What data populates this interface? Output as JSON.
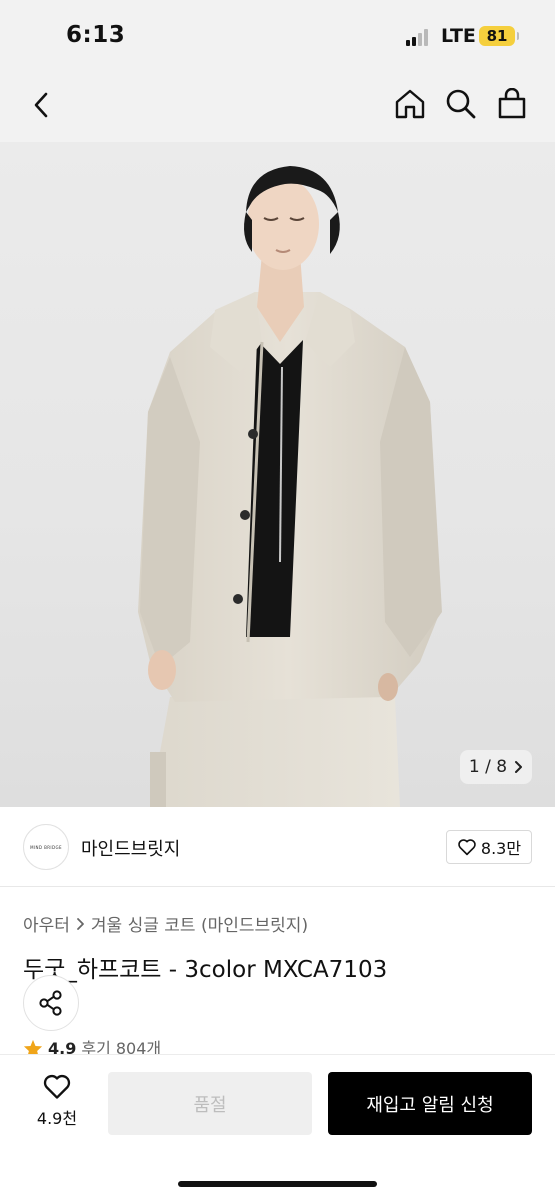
{
  "status_bar": {
    "time": "6:13",
    "network": "LTE",
    "battery": "81",
    "battery_color": "#f5cf3d"
  },
  "nav": {
    "back_icon": "chevron-left-icon",
    "home_icon": "home-icon",
    "search_icon": "search-icon",
    "cart_icon": "shopping-bag-icon"
  },
  "gallery": {
    "image_description_icon": "product-photo",
    "current": "1",
    "total": "8",
    "counter_text": "1 / 8"
  },
  "brand": {
    "logo_text": "MIND BRIDGE",
    "name": "마인드브릿지",
    "likes": "8.3만"
  },
  "product": {
    "breadcrumb": [
      "아우터",
      "겨울 싱글 코트 (마인드브릿지)"
    ],
    "title": "두굿_하프코트 - 3color MXCA7103",
    "rating": "4.9",
    "reviews": "후기 804개",
    "rating_color": "#f0a51a"
  },
  "bottom_bar": {
    "wish_count": "4.9천",
    "soldout_label": "품절",
    "restock_label": "재입고 알림 신청"
  }
}
